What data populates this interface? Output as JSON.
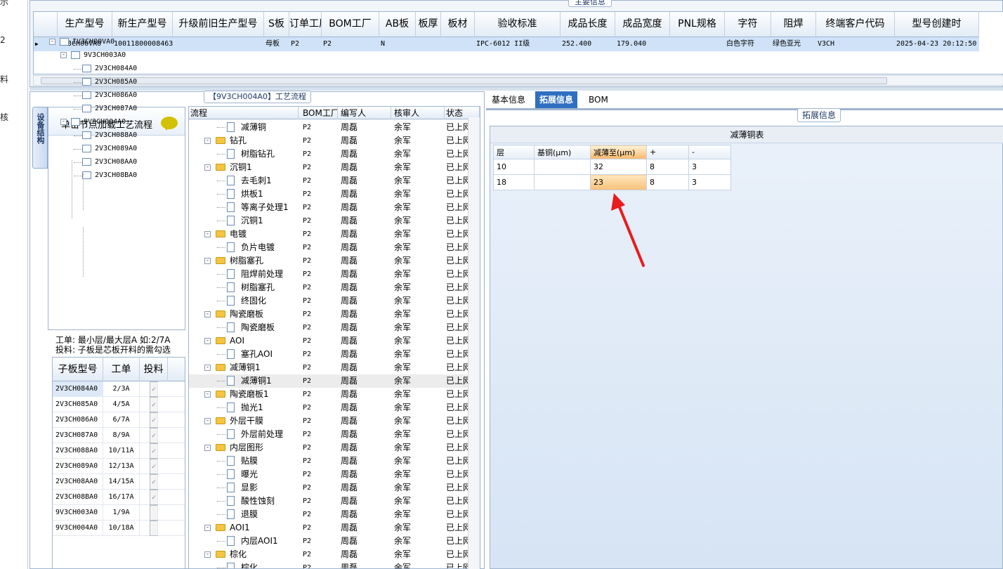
{
  "left_strip": [
    "示",
    "2",
    "料",
    "核"
  ],
  "main_group_title": "主要信息",
  "main_grid": {
    "columns": [
      "生产型号",
      "新生产型号",
      "升级前旧生产型号",
      "S板",
      "订单工厂",
      "BOM工厂",
      "AB板",
      "板厚",
      "板材",
      "验收标准",
      "成品长度",
      "成品宽度",
      "PNL规格",
      "字符",
      "阻焊",
      "终端客户代码",
      "型号创建时"
    ],
    "row": [
      "IV3CH00VA0",
      "10011800008463",
      "",
      "母板",
      "P2",
      "P2",
      "N",
      "",
      "",
      "IPC-6012 II级",
      "252.400",
      "179.040",
      "",
      "白色字符",
      "绿色亚光",
      "V3CH",
      "2025-04-23 20:12:50"
    ]
  },
  "left_tab": "设备结构",
  "tree": {
    "header": "单击节点加载工艺流程",
    "nodes": [
      {
        "label": "IV3CH00VA0",
        "level": 0,
        "exp": "-"
      },
      {
        "label": "9V3CH003A0",
        "level": 1,
        "exp": "-"
      },
      {
        "label": "2V3CH084A0",
        "level": 2
      },
      {
        "label": "2V3CH085A0",
        "level": 2
      },
      {
        "label": "2V3CH086A0",
        "level": 2
      },
      {
        "label": "2V3CH087A0",
        "level": 2
      },
      {
        "label": "9V3CH004A0",
        "level": 1,
        "exp": "-"
      },
      {
        "label": "2V3CH088A0",
        "level": 2
      },
      {
        "label": "2V3CH089A0",
        "level": 2
      },
      {
        "label": "2V3CH08AA0",
        "level": 2
      },
      {
        "label": "2V3CH08BA0",
        "level": 2
      }
    ]
  },
  "info": {
    "line1": "工单: 最小层/最大层A 如:2/7A",
    "line2": "投料: 子板是芯板开料的需勾选"
  },
  "sub_grid": {
    "columns": [
      "子板型号",
      "工单",
      "投料"
    ],
    "rows": [
      [
        "2V3CH084A0",
        "2/3A",
        true
      ],
      [
        "2V3CH085A0",
        "4/5A",
        true
      ],
      [
        "2V3CH086A0",
        "6/7A",
        true
      ],
      [
        "2V3CH087A0",
        "8/9A",
        true
      ],
      [
        "2V3CH088A0",
        "10/11A",
        true
      ],
      [
        "2V3CH089A0",
        "12/13A",
        true
      ],
      [
        "2V3CH08AA0",
        "14/15A",
        true
      ],
      [
        "2V3CH08BA0",
        "16/17A",
        true
      ],
      [
        "9V3CH003A0",
        "1/9A",
        false
      ],
      [
        "9V3CH004A0",
        "10/18A",
        false
      ]
    ]
  },
  "flow_title": "【9V3CH004A0】工艺流程",
  "flow_grid": {
    "columns": [
      "流程",
      "BOM工厂",
      "编写人",
      "核审人",
      "状态"
    ],
    "rows": [
      {
        "name": "减薄铜",
        "folder": false
      },
      {
        "name": "钻孔",
        "folder": true
      },
      {
        "name": "树脂钻孔",
        "folder": false
      },
      {
        "name": "沉铜1",
        "folder": true
      },
      {
        "name": "去毛刺1",
        "folder": false
      },
      {
        "name": "烘板1",
        "folder": false
      },
      {
        "name": "等离子处理1",
        "folder": false
      },
      {
        "name": "沉铜1",
        "folder": false
      },
      {
        "name": "电镀",
        "folder": true
      },
      {
        "name": "负片电镀",
        "folder": false
      },
      {
        "name": "树脂塞孔",
        "folder": true
      },
      {
        "name": "阻焊前处理",
        "folder": false
      },
      {
        "name": "树脂塞孔",
        "folder": false
      },
      {
        "name": "终固化",
        "folder": false
      },
      {
        "name": "陶瓷磨板",
        "folder": true
      },
      {
        "name": "陶瓷磨板",
        "folder": false
      },
      {
        "name": "AOI",
        "folder": true
      },
      {
        "name": "塞孔AOI",
        "folder": false
      },
      {
        "name": "减薄铜1",
        "folder": true
      },
      {
        "name": "减薄铜1",
        "folder": false,
        "selected": true
      },
      {
        "name": "陶瓷磨板1",
        "folder": true
      },
      {
        "name": "抛光1",
        "folder": false
      },
      {
        "name": "外层干膜",
        "folder": true
      },
      {
        "name": "外层前处理",
        "folder": false
      },
      {
        "name": "内层图形",
        "folder": true
      },
      {
        "name": "贴膜",
        "folder": false
      },
      {
        "name": "曝光",
        "folder": false
      },
      {
        "name": "显影",
        "folder": false
      },
      {
        "name": "酸性蚀刻",
        "folder": false
      },
      {
        "name": "退膜",
        "folder": false
      },
      {
        "name": "AOI1",
        "folder": true
      },
      {
        "name": "内层AOI1",
        "folder": false
      },
      {
        "name": "棕化",
        "folder": true
      },
      {
        "name": "棕化",
        "folder": false
      }
    ],
    "bom": "P2",
    "writer": "周磊",
    "reviewer": "余军",
    "status": "已上网"
  },
  "right_tabs": [
    "基本信息",
    "拓展信息",
    "BOM"
  ],
  "ext_label": "拓展信息",
  "thin_table": {
    "title": "减薄铜表",
    "columns": [
      "层",
      "基铜(μm)",
      "减薄至(μm)",
      "+",
      "-"
    ],
    "rows": [
      [
        "10",
        "",
        "32",
        "8",
        "3"
      ],
      [
        "18",
        "",
        "23",
        "8",
        "3"
      ]
    ]
  },
  "colors": {
    "accent": "#2f6fc1",
    "selected_row": "#cfe2f8",
    "highlight": "#f8b86a",
    "arrow": "#e81c1c"
  }
}
